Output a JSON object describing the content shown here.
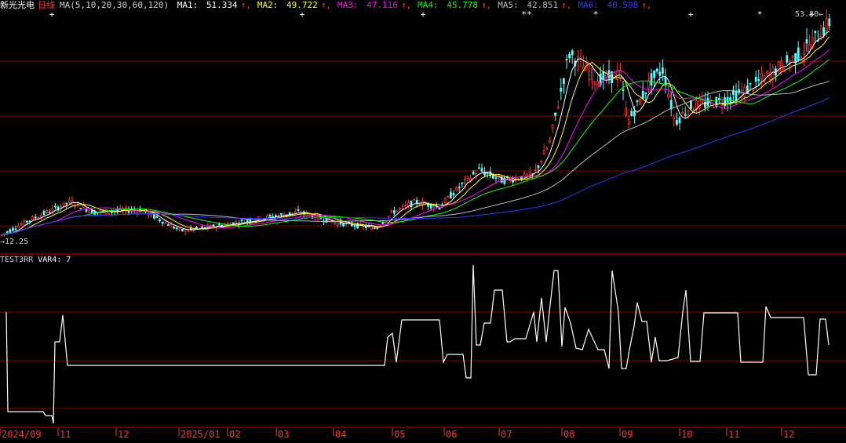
{
  "header": {
    "stock_name": "新光光电",
    "period": "日线",
    "ma_spec": "MA(5,10,20,30,60,120)",
    "ma_values": [
      {
        "name": "MA1:",
        "value": "51.334",
        "color": "#ffffff"
      },
      {
        "name": "MA2:",
        "value": "49.722",
        "color": "#ffff00"
      },
      {
        "name": "MA3:",
        "value": "47.116",
        "color": "#ff00ff"
      },
      {
        "name": "MA4:",
        "value": "45.778",
        "color": "#00ff00"
      },
      {
        "name": "MA5:",
        "value": "42.851",
        "color": "#bdbdbd"
      },
      {
        "name": "MA6:",
        "value": "40.598",
        "color": "#3333ff"
      }
    ],
    "arrow": "↑"
  },
  "price_panel": {
    "high_label": "53.80",
    "low_label": "12.25",
    "high_marker": "←",
    "low_marker": "→",
    "signal_marks": [
      {
        "symbol": "+",
        "index": 6
      },
      {
        "symbol": "+",
        "index": 35
      },
      {
        "symbol": "+",
        "index": 49
      },
      {
        "symbol": "**",
        "index": 61
      },
      {
        "symbol": "*",
        "index": 69
      },
      {
        "symbol": "+",
        "index": 80
      },
      {
        "symbol": "*",
        "index": 88
      },
      {
        "symbol": "+",
        "index": 94
      }
    ]
  },
  "indicator_panel": {
    "name": "TEST3RR",
    "var_label": "VAR4:",
    "var_value": "7"
  },
  "time_axis": [
    "2024/09",
    "11",
    "12",
    "2025/01",
    "02",
    "03",
    "04",
    "05",
    "06",
    "07",
    "08",
    "09",
    "10",
    "11",
    "12"
  ],
  "colors": {
    "grid": "#8b0000",
    "axis_text": "#ff3030",
    "candle_up": "#ff3333",
    "candle_down": "#54ffff",
    "indicator_line": "#ffffff"
  }
}
